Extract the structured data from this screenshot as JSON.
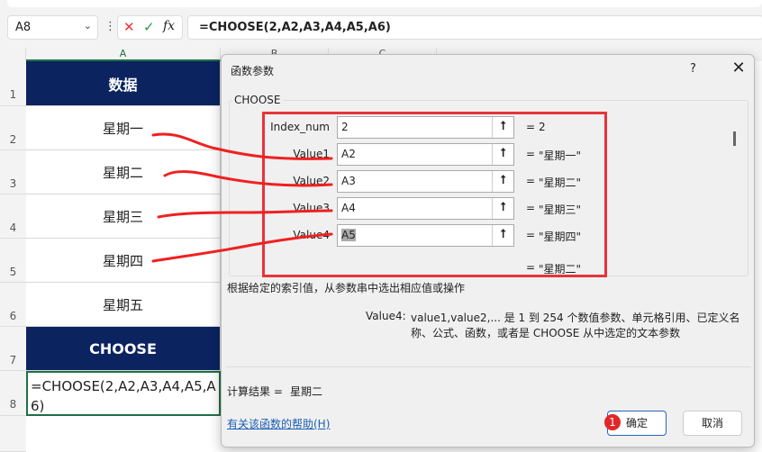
{
  "formula_bar": {
    "name_box": "A8",
    "formula": "=CHOOSE(2,A2,A3,A4,A5,A6)",
    "cancel_icon": "✕",
    "enter_icon": "✓",
    "fx": "fx"
  },
  "columns": [
    "A",
    "B",
    "C"
  ],
  "rows": [
    {
      "num": "1",
      "value": "数据"
    },
    {
      "num": "2",
      "value": "星期一"
    },
    {
      "num": "3",
      "value": "星期二"
    },
    {
      "num": "4",
      "value": "星期三"
    },
    {
      "num": "5",
      "value": "星期四"
    },
    {
      "num": "6",
      "value": "星期五"
    },
    {
      "num": "7",
      "value": "CHOOSE"
    },
    {
      "num": "8",
      "value": "=CHOOSE(2,A2,A3,A4,A5,A6)"
    }
  ],
  "dialog": {
    "title": "函数参数",
    "help": "?",
    "close": "✕",
    "function_name": "CHOOSE",
    "args": [
      {
        "label": "Index_num",
        "value": "2",
        "result": "2"
      },
      {
        "label": "Value1",
        "value": "A2",
        "result": "\"星期一\""
      },
      {
        "label": "Value2",
        "value": "A3",
        "result": "\"星期二\""
      },
      {
        "label": "Value3",
        "value": "A4",
        "result": "\"星期三\""
      },
      {
        "label": "Value4",
        "value": "A5",
        "result": "\"星期四\""
      }
    ],
    "eq": "=",
    "overall_result": "\"星期二\"",
    "description": "根据给定的索引值，从参数串中选出相应值或操作",
    "arg_name": "Value4:",
    "arg_desc1": "value1,value2,... 是 1 到 254 个数值参数、单元格引用、已定义名",
    "arg_desc2": "称、公式、函数，或者是 CHOOSE 从中选定的文本参数",
    "calc_label": "计算结果 =",
    "calc_value": "星期二",
    "help_link": "有关该函数的帮助(H)",
    "ok": "确定",
    "cancel": "取消",
    "badge": "1"
  }
}
